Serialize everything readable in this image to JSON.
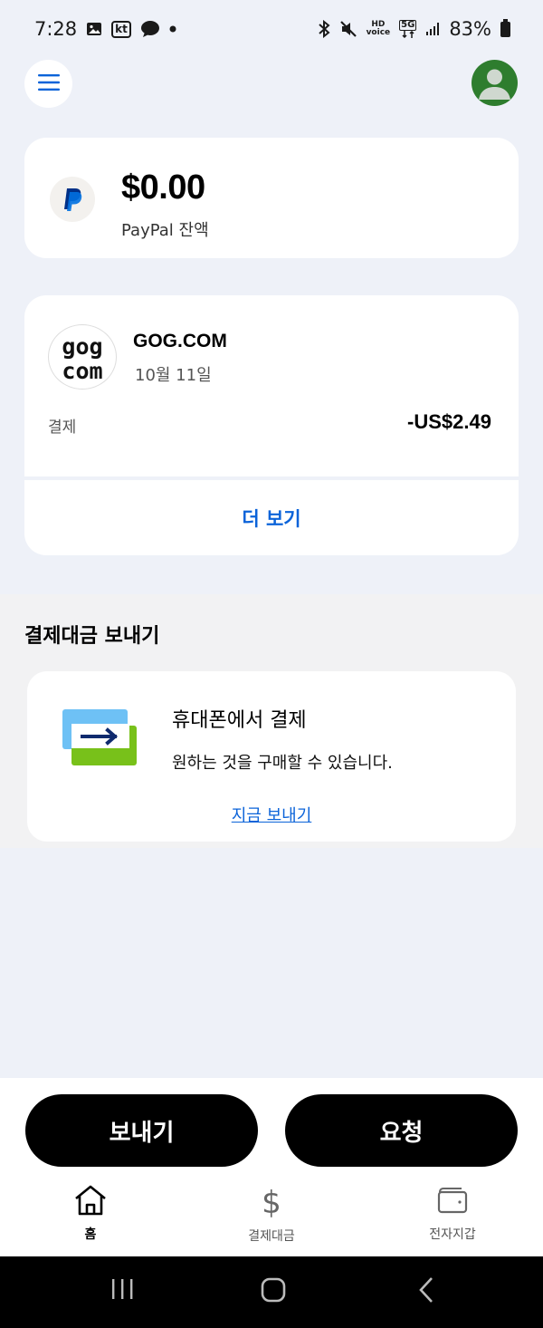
{
  "status_bar": {
    "time": "7:28",
    "carrier": "kt",
    "hd_top": "HD",
    "hd_bottom": "voice",
    "network": "5G",
    "battery": "83%",
    "icons": [
      "image-icon",
      "kt-icon",
      "chat-bubble-icon",
      "dot-icon",
      "bluetooth-icon",
      "mute-icon",
      "hd-voice-icon",
      "5g-icon",
      "signal-icon",
      "battery-icon"
    ]
  },
  "header": {
    "menu_icon": "hamburger-menu-icon",
    "avatar_icon": "user-avatar-icon"
  },
  "balance": {
    "amount": "$0.00",
    "label": "PayPal 잔액",
    "logo_icon": "paypal-logo-icon"
  },
  "activity": {
    "merchant": "GOG.COM",
    "date": "10월 11일",
    "type": "결제",
    "amount": "-US$2.49",
    "logo_top": "gog",
    "logo_bottom": "com",
    "more_label": "더 보기"
  },
  "send_section": {
    "heading": "결제대금 보내기",
    "card_title": "휴대폰에서 결제",
    "card_desc": "원하는 것을 구매할 수 있습니다.",
    "link_label": "지금 보내기",
    "illustration_icon": "send-card-arrow-icon"
  },
  "actions": {
    "send_label": "보내기",
    "request_label": "요청"
  },
  "bottom_nav": {
    "items": [
      {
        "label": "홈",
        "icon": "home-icon",
        "active": true
      },
      {
        "label": "결제대금",
        "icon": "dollar-icon",
        "active": false
      },
      {
        "label": "전자지갑",
        "icon": "wallet-icon",
        "active": false
      }
    ]
  },
  "system_nav": {
    "icons": [
      "recents-icon",
      "home-circle-icon",
      "back-icon"
    ]
  },
  "colors": {
    "background": "#eef1f8",
    "link_blue": "#0b63d9",
    "button_black": "#000000",
    "avatar_green": "#2e7d2e",
    "illus_light_blue": "#6ec1f5",
    "illus_green": "#78c11a"
  }
}
